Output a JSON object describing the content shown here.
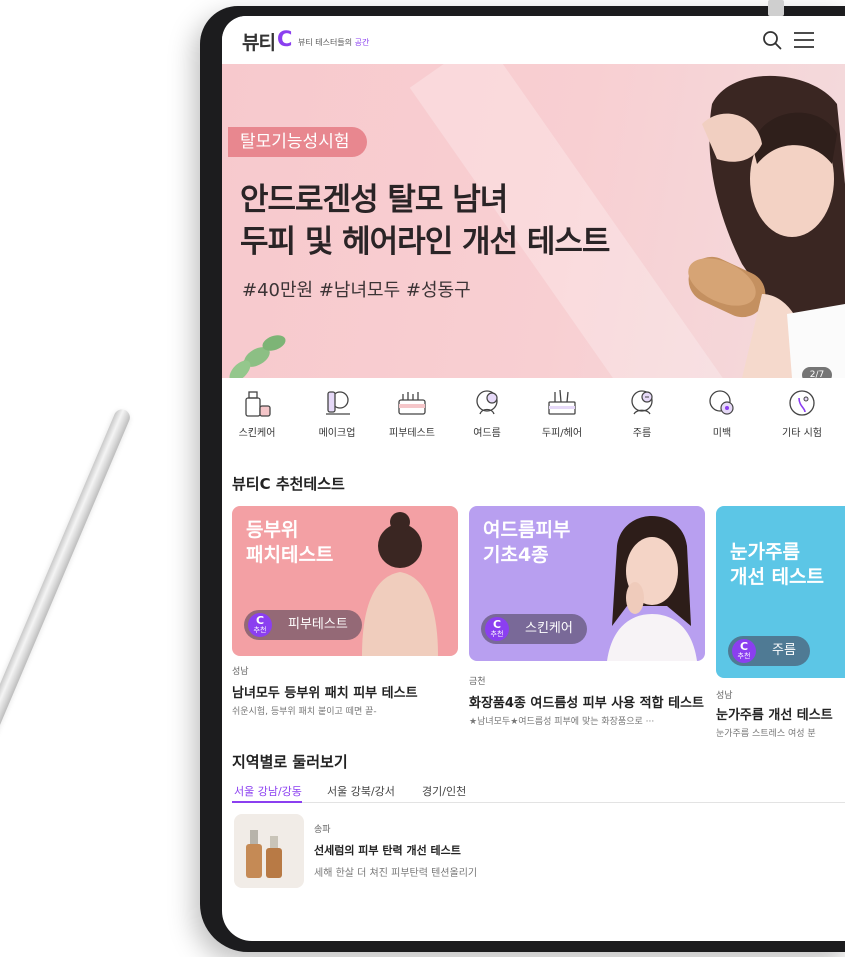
{
  "header": {
    "logo_text": "뷰티",
    "logo_c": "C",
    "tagline_prefix": "뷰티 테스터들의 ",
    "tagline_accent": "공간",
    "icons": [
      "search-icon",
      "menu-icon"
    ]
  },
  "banner": {
    "badge": "탈모기능성시험",
    "headline_line1": "안드로겐성 탈모 남녀",
    "headline_line2": "두피 및 헤어라인 개선 테스트",
    "hashtags": "#40만원 #남녀모두 #성동구",
    "page_indicator": "2/7"
  },
  "categories": [
    {
      "label": "스킨케어",
      "icon": "skincare-icon"
    },
    {
      "label": "메이크업",
      "icon": "makeup-icon"
    },
    {
      "label": "피부테스트",
      "icon": "skin-test-icon"
    },
    {
      "label": "여드름",
      "icon": "acne-icon"
    },
    {
      "label": "두피/헤어",
      "icon": "scalp-hair-icon"
    },
    {
      "label": "주름",
      "icon": "wrinkle-icon"
    },
    {
      "label": "미백",
      "icon": "whitening-icon"
    },
    {
      "label": "기타 시험",
      "icon": "other-test-icon"
    }
  ],
  "recommended": {
    "title": "뷰티C 추천테스트",
    "badge_c": "C",
    "badge_text": "추천",
    "cards": [
      {
        "img_title_1": "등부위",
        "img_title_2": "패치테스트",
        "pill": "피부테스트",
        "location": "성남",
        "name": "남녀모두 등부위 패치 피부 테스트",
        "desc": "쉬운시험, 등부위 패치 붙이고 떼면 끝-",
        "color": "#f3a0a4"
      },
      {
        "img_title_1": "여드름피부",
        "img_title_2": "기초4종",
        "pill": "스킨케어",
        "location": "금천",
        "name": "화장품4종 여드름성 피부 사용 적합 테스트",
        "desc": "★남녀모두★여드름성 피부에 맞는 화장품으로 ···",
        "color": "#b89ff0"
      },
      {
        "img_title_1": "눈가주름",
        "img_title_2": "개선 테스트",
        "pill": "주름",
        "location": "성남",
        "name": "눈가주름 개선 테스트",
        "desc": "눈가주름 스트레스 여성 분",
        "color": "#5cc6e6"
      }
    ]
  },
  "regions": {
    "title": "지역별로 둘러보기",
    "tabs": [
      "서울 강남/강동",
      "서울 강북/강서",
      "경기/인천"
    ],
    "active_tab": 0,
    "items": [
      {
        "location": "송파",
        "name": "선세럼의 피부 탄력 개선 테스트",
        "desc": "세해 한살 더 쳐진 피부탄력 텐션올리기"
      }
    ]
  },
  "colors": {
    "brand": "#8b3ff0",
    "banner_bg": "#f7c9cd",
    "badge_bg": "#e8878f"
  }
}
